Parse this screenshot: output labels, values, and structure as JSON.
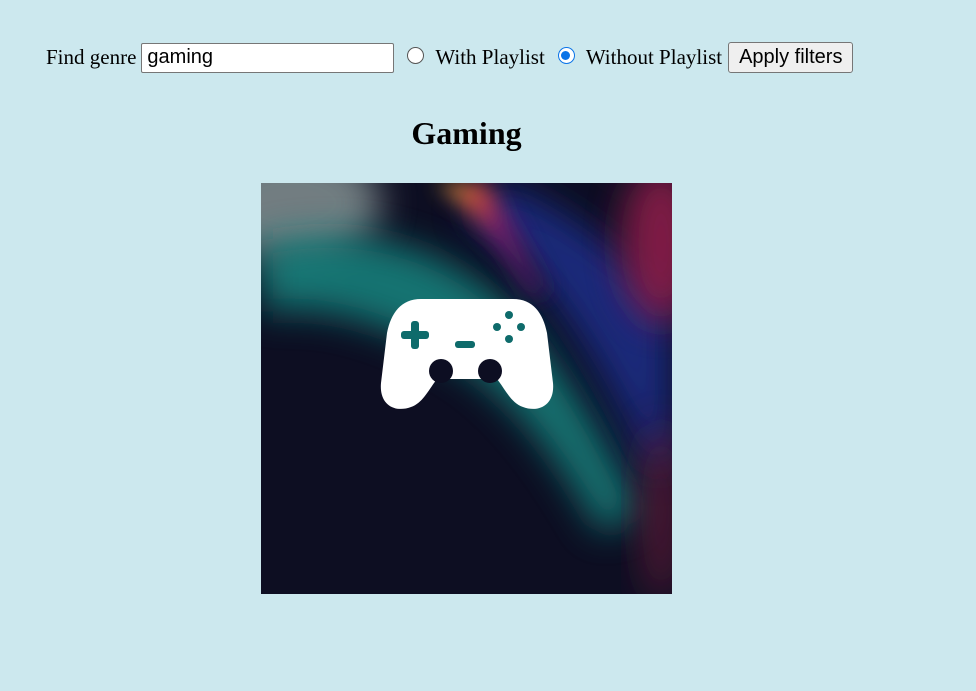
{
  "filters": {
    "find_label": "Find genre",
    "search_value": "gaming",
    "with_playlist_label": "With Playlist",
    "without_playlist_label": "Without Playlist",
    "selected_option": "Without Playlist",
    "apply_label": "Apply filters"
  },
  "genre": {
    "title": "Gaming",
    "image_icon": "gamepad-icon"
  },
  "colors": {
    "page_background": "#cce8ee",
    "radio_accent": "#0b74e8",
    "image_background": "#0d0e22",
    "icon_fill": "#ffffff",
    "icon_detail": "#0e6b6b"
  }
}
